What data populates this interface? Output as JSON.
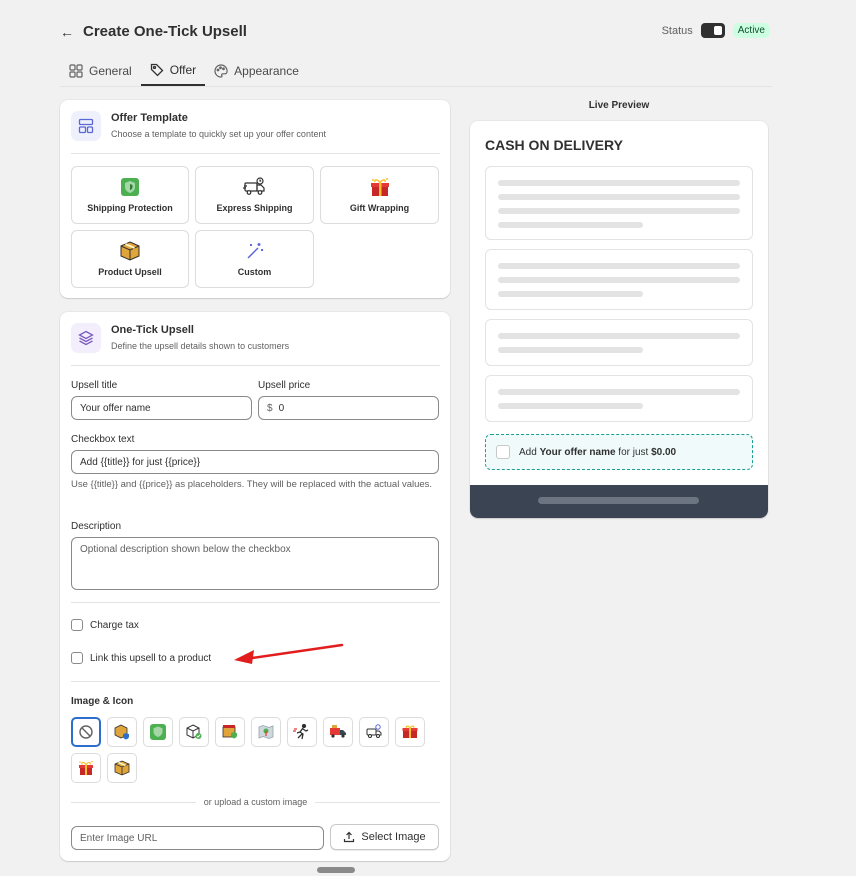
{
  "header": {
    "title": "Create One-Tick Upsell",
    "status_label": "Status",
    "status_badge": "Active"
  },
  "tabs": [
    {
      "label": "General",
      "icon": "grid-icon",
      "active": false
    },
    {
      "label": "Offer",
      "icon": "tag-icon",
      "active": true
    },
    {
      "label": "Appearance",
      "icon": "palette-icon",
      "active": false
    }
  ],
  "offer_template": {
    "title": "Offer Template",
    "subtitle": "Choose a template to quickly set up your offer content",
    "templates": [
      {
        "label": "Shipping Protection",
        "icon": "shield-icon"
      },
      {
        "label": "Express Shipping",
        "icon": "truck-icon"
      },
      {
        "label": "Gift Wrapping",
        "icon": "gift-icon"
      },
      {
        "label": "Product Upsell",
        "icon": "box-icon"
      },
      {
        "label": "Custom",
        "icon": "magic-wand-icon"
      }
    ]
  },
  "upsell": {
    "title": "One-Tick Upsell",
    "subtitle": "Define the upsell details shown to customers",
    "upsell_title_label": "Upsell title",
    "upsell_title_value": "Your offer name",
    "upsell_price_label": "Upsell price",
    "upsell_price_prefix": "$",
    "upsell_price_value": "0",
    "checkbox_text_label": "Checkbox text",
    "checkbox_text_value": "Add {{title}} for just {{price}}",
    "checkbox_help": "Use {{title}} and {{price}} as placeholders. They will be replaced with the actual values.",
    "description_label": "Description",
    "description_placeholder": "Optional description shown below the checkbox",
    "charge_tax_label": "Charge tax",
    "link_product_label": "Link this upsell to a product",
    "image_icon_label": "Image & Icon",
    "icons": [
      "none-icon",
      "box-shield-icon",
      "shield-icon",
      "box-check-icon",
      "box-shield-color-icon",
      "map-icon",
      "runner-icon",
      "delivery-truck-icon",
      "scooter-icon",
      "gift-box-icon",
      "gift-open-icon",
      "package-icon"
    ],
    "or_upload_text": "or upload a custom image",
    "image_url_placeholder": "Enter Image URL",
    "select_image_label": "Select Image"
  },
  "preview": {
    "label": "Live Preview",
    "heading": "CASH ON DELIVERY",
    "upsell_prefix": "Add ",
    "upsell_name": "Your offer name",
    "upsell_mid": " for just ",
    "upsell_price": "$0.00"
  },
  "colors": {
    "accent": "#2c6ecb",
    "badge_bg": "#cdfee1",
    "preview_footer": "#3b4452",
    "upsell_border": "#1a9e8f",
    "arrow": "#e11d1d"
  }
}
